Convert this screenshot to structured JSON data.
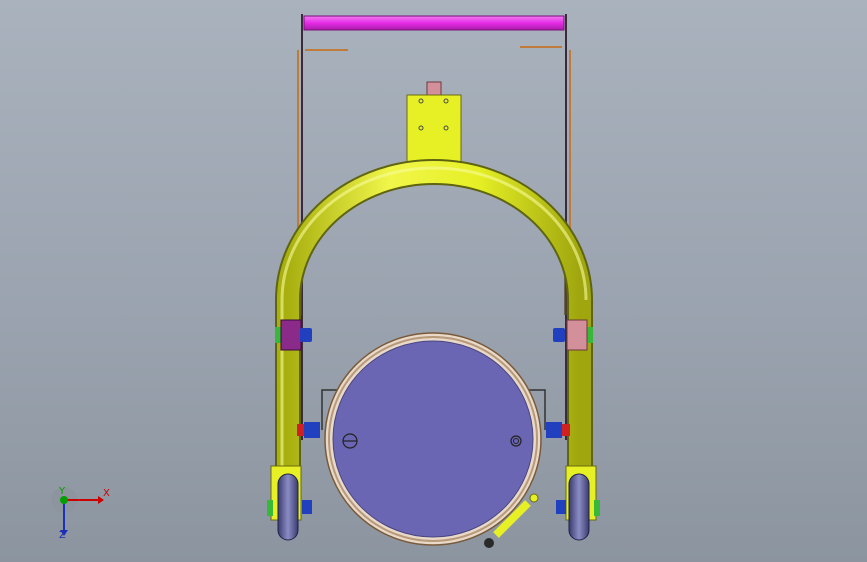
{
  "viewport": {
    "background_top": "#a9b2bd",
    "background_bottom": "#8c959f"
  },
  "model": {
    "name": "",
    "colors": {
      "handle_bar": "#e62be6",
      "frame_arch": "#e6f025",
      "mount_plate": "#e6f025",
      "drum_lid": "#6a66b4",
      "drum_rim": "#b89a7a",
      "wheel": "#6d6fa6",
      "wheel_bracket": "#e6f025",
      "guide_rod": "#c07a3a",
      "clamp_block": "#8a2b8a",
      "bolt_blue": "#2040c0",
      "bolt_green": "#38b838",
      "bolt_red": "#d02020"
    }
  },
  "triad": {
    "x_label": "X",
    "y_label": "Y",
    "z_label": "Z",
    "colors": {
      "x": "#cc0000",
      "y": "#00a000",
      "z": "#1d2fb8"
    }
  }
}
